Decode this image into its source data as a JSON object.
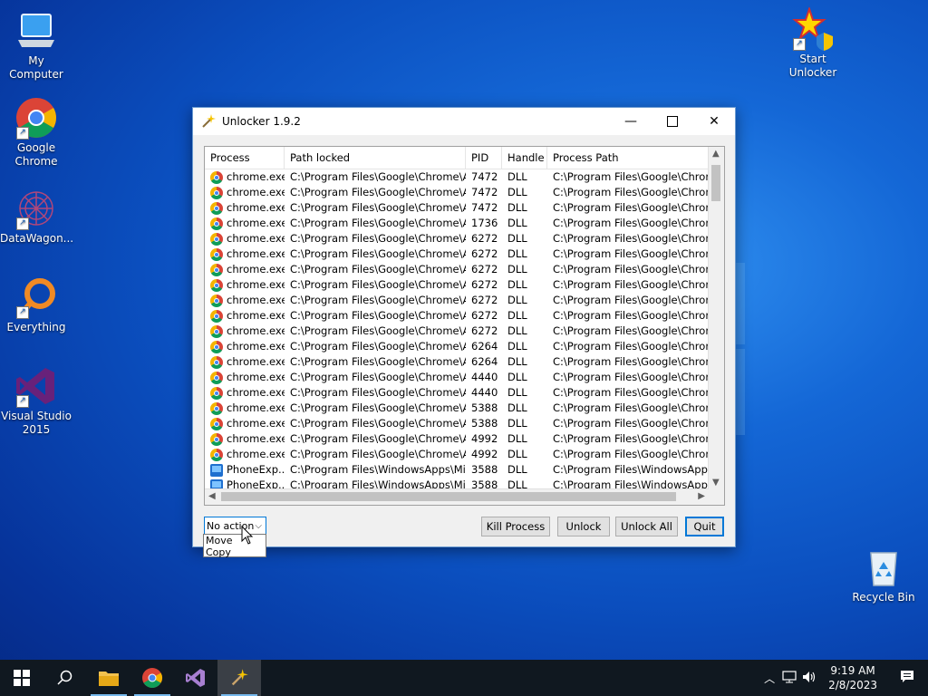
{
  "desktop": {
    "icons": [
      {
        "label": "My Computer"
      },
      {
        "label": "Google Chrome"
      },
      {
        "label": "DataWagon..."
      },
      {
        "label": "Everything"
      },
      {
        "label": "Visual Studio 2015"
      },
      {
        "label": "Start Unlocker"
      },
      {
        "label": "Recycle Bin"
      }
    ]
  },
  "window": {
    "title": "Unlocker 1.9.2",
    "columns": [
      "Process",
      "Path locked",
      "PID",
      "Handle",
      "Process Path"
    ],
    "rows": [
      {
        "icon": "chrome-icon",
        "process": "chrome.exe",
        "path": "C:\\Program Files\\Google\\Chrome\\Ap...",
        "pid": "7472",
        "handle": "DLL",
        "proc_path": "C:\\Program Files\\Google\\Chrome\\Ap"
      },
      {
        "icon": "chrome-icon",
        "process": "chrome.exe",
        "path": "C:\\Program Files\\Google\\Chrome\\Ap...",
        "pid": "7472",
        "handle": "DLL",
        "proc_path": "C:\\Program Files\\Google\\Chrome\\Ap"
      },
      {
        "icon": "chrome-icon",
        "process": "chrome.exe",
        "path": "C:\\Program Files\\Google\\Chrome\\Ap...",
        "pid": "7472",
        "handle": "DLL",
        "proc_path": "C:\\Program Files\\Google\\Chrome\\Ap"
      },
      {
        "icon": "chrome-icon",
        "process": "chrome.exe",
        "path": "C:\\Program Files\\Google\\Chrome\\Ap...",
        "pid": "1736",
        "handle": "DLL",
        "proc_path": "C:\\Program Files\\Google\\Chrome\\Ap"
      },
      {
        "icon": "chrome-icon",
        "process": "chrome.exe",
        "path": "C:\\Program Files\\Google\\Chrome\\Ap...",
        "pid": "6272",
        "handle": "DLL",
        "proc_path": "C:\\Program Files\\Google\\Chrome\\Ap"
      },
      {
        "icon": "chrome-icon",
        "process": "chrome.exe",
        "path": "C:\\Program Files\\Google\\Chrome\\Ap...",
        "pid": "6272",
        "handle": "DLL",
        "proc_path": "C:\\Program Files\\Google\\Chrome\\Ap"
      },
      {
        "icon": "chrome-icon",
        "process": "chrome.exe",
        "path": "C:\\Program Files\\Google\\Chrome\\Ap...",
        "pid": "6272",
        "handle": "DLL",
        "proc_path": "C:\\Program Files\\Google\\Chrome\\Ap"
      },
      {
        "icon": "chrome-icon",
        "process": "chrome.exe",
        "path": "C:\\Program Files\\Google\\Chrome\\Ap...",
        "pid": "6272",
        "handle": "DLL",
        "proc_path": "C:\\Program Files\\Google\\Chrome\\Ap"
      },
      {
        "icon": "chrome-icon",
        "process": "chrome.exe",
        "path": "C:\\Program Files\\Google\\Chrome\\Ap...",
        "pid": "6272",
        "handle": "DLL",
        "proc_path": "C:\\Program Files\\Google\\Chrome\\Ap"
      },
      {
        "icon": "chrome-icon",
        "process": "chrome.exe",
        "path": "C:\\Program Files\\Google\\Chrome\\Ap...",
        "pid": "6272",
        "handle": "DLL",
        "proc_path": "C:\\Program Files\\Google\\Chrome\\Ap"
      },
      {
        "icon": "chrome-icon",
        "process": "chrome.exe",
        "path": "C:\\Program Files\\Google\\Chrome\\Ap...",
        "pid": "6272",
        "handle": "DLL",
        "proc_path": "C:\\Program Files\\Google\\Chrome\\Ap"
      },
      {
        "icon": "chrome-icon",
        "process": "chrome.exe",
        "path": "C:\\Program Files\\Google\\Chrome\\Ap...",
        "pid": "6264",
        "handle": "DLL",
        "proc_path": "C:\\Program Files\\Google\\Chrome\\Ap"
      },
      {
        "icon": "chrome-icon",
        "process": "chrome.exe",
        "path": "C:\\Program Files\\Google\\Chrome\\Ap...",
        "pid": "6264",
        "handle": "DLL",
        "proc_path": "C:\\Program Files\\Google\\Chrome\\Ap"
      },
      {
        "icon": "chrome-icon",
        "process": "chrome.exe",
        "path": "C:\\Program Files\\Google\\Chrome\\Ap...",
        "pid": "4440",
        "handle": "DLL",
        "proc_path": "C:\\Program Files\\Google\\Chrome\\Ap"
      },
      {
        "icon": "chrome-icon",
        "process": "chrome.exe",
        "path": "C:\\Program Files\\Google\\Chrome\\Ap...",
        "pid": "4440",
        "handle": "DLL",
        "proc_path": "C:\\Program Files\\Google\\Chrome\\Ap"
      },
      {
        "icon": "chrome-icon",
        "process": "chrome.exe",
        "path": "C:\\Program Files\\Google\\Chrome\\Ap...",
        "pid": "5388",
        "handle": "DLL",
        "proc_path": "C:\\Program Files\\Google\\Chrome\\Ap"
      },
      {
        "icon": "chrome-icon",
        "process": "chrome.exe",
        "path": "C:\\Program Files\\Google\\Chrome\\Ap...",
        "pid": "5388",
        "handle": "DLL",
        "proc_path": "C:\\Program Files\\Google\\Chrome\\Ap"
      },
      {
        "icon": "chrome-icon",
        "process": "chrome.exe",
        "path": "C:\\Program Files\\Google\\Chrome\\Ap...",
        "pid": "4992",
        "handle": "DLL",
        "proc_path": "C:\\Program Files\\Google\\Chrome\\Ap"
      },
      {
        "icon": "chrome-icon",
        "process": "chrome.exe",
        "path": "C:\\Program Files\\Google\\Chrome\\Ap...",
        "pid": "4992",
        "handle": "DLL",
        "proc_path": "C:\\Program Files\\Google\\Chrome\\Ap"
      },
      {
        "icon": "phone-icon",
        "process": "PhoneExp...",
        "path": "C:\\Program Files\\WindowsApps\\Micr...",
        "pid": "3588",
        "handle": "DLL",
        "proc_path": "C:\\Program Files\\WindowsApps\\Micr"
      },
      {
        "icon": "phone-icon",
        "process": "PhoneExp...",
        "path": "C:\\Program Files\\WindowsApps\\Micr...",
        "pid": "3588",
        "handle": "DLL",
        "proc_path": "C:\\Program Files\\WindowsApps\\Micr"
      }
    ],
    "action_select": {
      "value": "No action",
      "options": [
        "Move",
        "Copy"
      ]
    },
    "buttons": {
      "kill": "Kill Process",
      "unlock": "Unlock",
      "unlock_all": "Unlock All",
      "quit": "Quit"
    }
  },
  "taskbar": {
    "time": "9:19 AM",
    "date": "2/8/2023"
  },
  "colors": {
    "accent": "#0078d7",
    "taskbar": "#101820"
  }
}
